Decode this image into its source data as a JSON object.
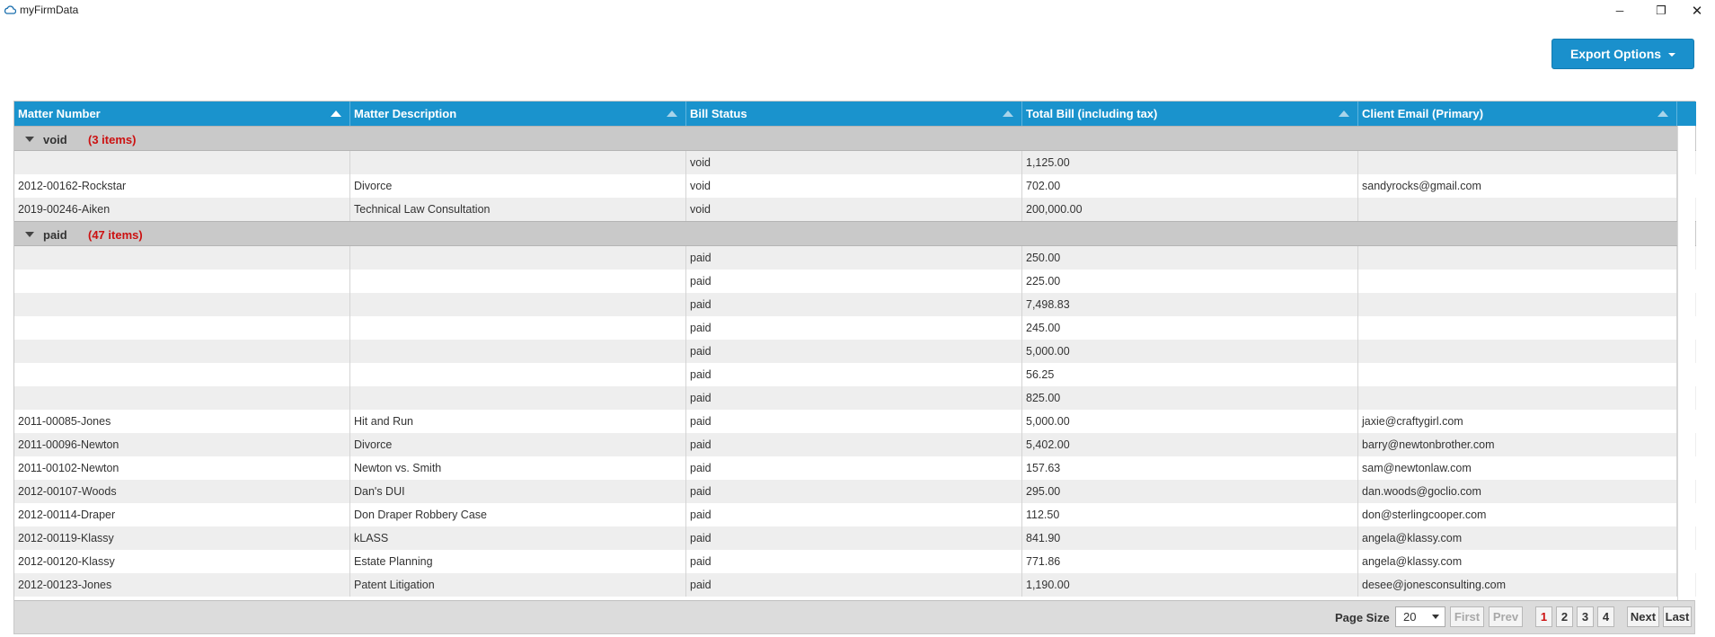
{
  "window": {
    "title": "myFirmData",
    "icon": "cloud-icon",
    "controls": {
      "minimize": "─",
      "restore": "❐",
      "close": "✕"
    }
  },
  "toolbar": {
    "export_label": "Export Options"
  },
  "grid": {
    "columns": [
      {
        "label": "Matter Number"
      },
      {
        "label": "Matter Description"
      },
      {
        "label": "Bill Status"
      },
      {
        "label": "Total Bill (including tax)"
      },
      {
        "label": "Client Email (Primary)"
      }
    ],
    "groups": [
      {
        "name": "void",
        "count_label": "(3 items)",
        "rows": [
          [
            "",
            "",
            "void",
            "1,125.00",
            ""
          ],
          [
            "2012-00162-Rockstar",
            "Divorce",
            "void",
            "702.00",
            "sandyrocks@gmail.com"
          ],
          [
            "2019-00246-Aiken",
            "Technical Law Consultation",
            "void",
            "200,000.00",
            ""
          ]
        ]
      },
      {
        "name": "paid",
        "count_label": "(47 items)",
        "rows": [
          [
            "",
            "",
            "paid",
            "250.00",
            ""
          ],
          [
            "",
            "",
            "paid",
            "225.00",
            ""
          ],
          [
            "",
            "",
            "paid",
            "7,498.83",
            ""
          ],
          [
            "",
            "",
            "paid",
            "245.00",
            ""
          ],
          [
            "",
            "",
            "paid",
            "5,000.00",
            ""
          ],
          [
            "",
            "",
            "paid",
            "56.25",
            ""
          ],
          [
            "",
            "",
            "paid",
            "825.00",
            ""
          ],
          [
            "2011-00085-Jones",
            "Hit and Run",
            "paid",
            "5,000.00",
            "jaxie@craftygirl.com"
          ],
          [
            "2011-00096-Newton",
            "Divorce",
            "paid",
            "5,402.00",
            "barry@newtonbrother.com"
          ],
          [
            "2011-00102-Newton",
            "Newton vs. Smith",
            "paid",
            "157.63",
            "sam@newtonlaw.com"
          ],
          [
            "2012-00107-Woods",
            "Dan's DUI",
            "paid",
            "295.00",
            "dan.woods@goclio.com"
          ],
          [
            "2012-00114-Draper",
            "Don Draper Robbery Case",
            "paid",
            "112.50",
            "don@sterlingcooper.com"
          ],
          [
            "2012-00119-Klassy",
            "kLASS",
            "paid",
            "841.90",
            "angela@klassy.com"
          ],
          [
            "2012-00120-Klassy",
            "Estate Planning",
            "paid",
            "771.86",
            "angela@klassy.com"
          ],
          [
            "2012-00123-Jones",
            "Patent Litigation",
            "paid",
            "1,190.00",
            "desee@jonesconsulting.com"
          ]
        ]
      }
    ]
  },
  "pager": {
    "page_size_label": "Page Size",
    "page_size": "20",
    "first": "First",
    "prev": "Prev",
    "pages": [
      "1",
      "2",
      "3",
      "4"
    ],
    "current_page": "1",
    "next": "Next",
    "last": "Last"
  }
}
